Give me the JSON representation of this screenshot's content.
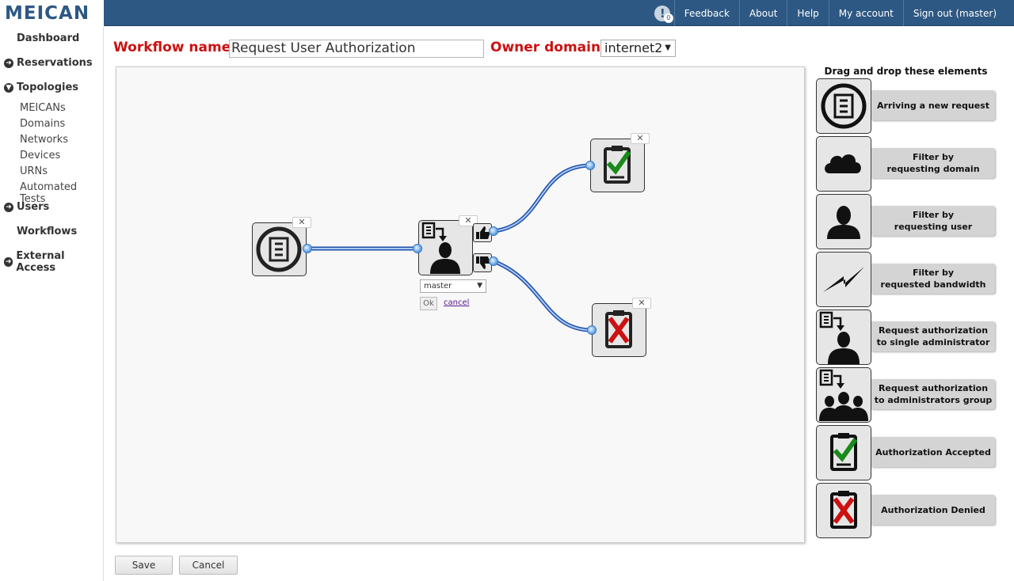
{
  "app": {
    "logo": "MEICAN"
  },
  "topnav": {
    "notification_count": "0",
    "items": [
      "Feedback",
      "About",
      "Help",
      "My account",
      "Sign out (master)"
    ]
  },
  "sidebar": {
    "dashboard": "Dashboard",
    "reservations": "Reservations",
    "topologies": "Topologies",
    "topology_items": [
      "MEICANs",
      "Domains",
      "Networks",
      "Devices",
      "URNs",
      "Automated Tests"
    ],
    "users": "Users",
    "workflows": "Workflows",
    "external_access": "External Access"
  },
  "form": {
    "workflow_name_label": "Workflow name:",
    "workflow_name_value": "Request User Authorization",
    "owner_domain_label": "Owner domain:",
    "owner_domain_value": "internet2"
  },
  "canvas": {
    "admin_select_value": "master",
    "ok_label": "Ok",
    "cancel_label": "cancel"
  },
  "palette": {
    "title": "Drag and drop these elements",
    "items": [
      {
        "label": "Arriving a new request",
        "icon": "new-request-icon"
      },
      {
        "label": "Filter by\nrequesting domain",
        "icon": "cloud-icon"
      },
      {
        "label": "Filter by\nrequesting user",
        "icon": "user-icon"
      },
      {
        "label": "Filter by\nrequested bandwidth",
        "icon": "lightning-icon"
      },
      {
        "label": "Request authorization\nto single administrator",
        "icon": "single-admin-icon"
      },
      {
        "label": "Request authorization\nto administrators group",
        "icon": "admin-group-icon"
      },
      {
        "label": "Authorization Accepted",
        "icon": "accepted-icon"
      },
      {
        "label": "Authorization Denied",
        "icon": "denied-icon"
      }
    ]
  },
  "buttons": {
    "save": "Save",
    "cancel": "Cancel"
  },
  "colors": {
    "topbar": "#2d5883",
    "label_red": "#cc1111",
    "wire": "#3a78c0",
    "check_green": "#1a8a1a",
    "deny_red": "#cc1111"
  }
}
